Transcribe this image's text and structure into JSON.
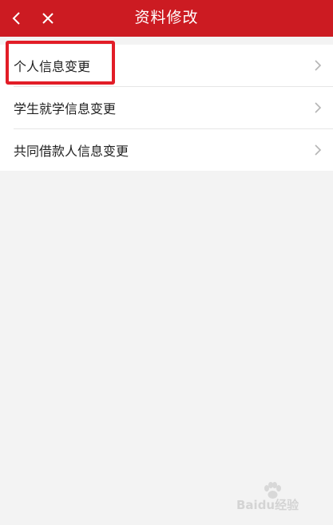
{
  "header": {
    "title": "资料修改",
    "back_icon": "chevron-left-icon",
    "close_icon": "close-icon"
  },
  "menu": {
    "items": [
      {
        "label": "个人信息变更"
      },
      {
        "label": "学生就学信息变更"
      },
      {
        "label": "共同借款人信息变更"
      }
    ]
  },
  "watermark": {
    "text": "Baidu经验"
  },
  "colors": {
    "accent": "#cc1b22",
    "highlight": "#e21d27",
    "background": "#f3f3f3"
  }
}
